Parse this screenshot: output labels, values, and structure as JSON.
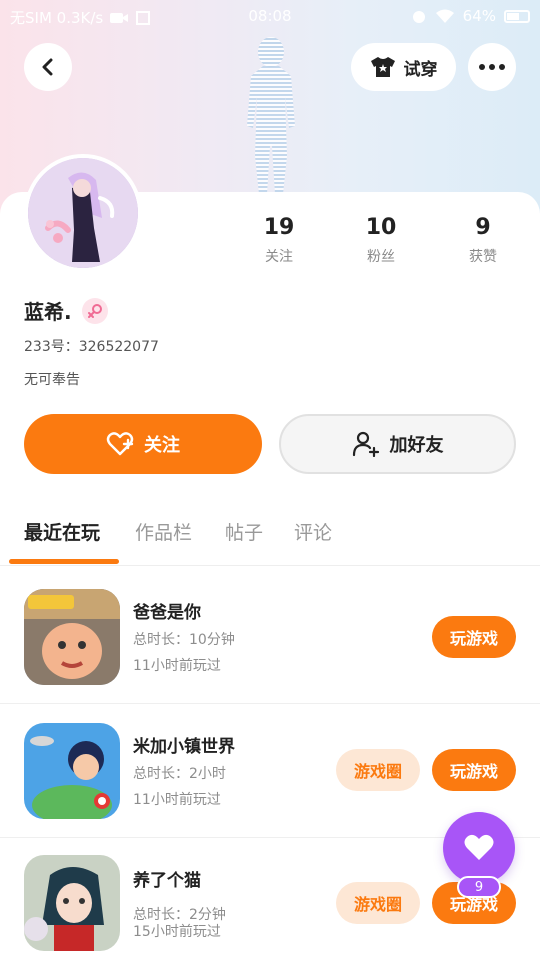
{
  "status_bar": {
    "left_text": "无SIM 0.3K/s",
    "time": "08:08",
    "battery": "64%"
  },
  "header": {
    "tryon_label": "试穿"
  },
  "profile": {
    "name": "蓝希.",
    "uid": "233号：326522077",
    "bio": "无可奉告",
    "stats": [
      {
        "value": "19",
        "label": "关注"
      },
      {
        "value": "10",
        "label": "粉丝"
      },
      {
        "value": "9",
        "label": "获赞"
      }
    ]
  },
  "actions": {
    "follow_label": "关注",
    "add_friend_label": "加好友"
  },
  "tabs": [
    {
      "label": "最近在玩",
      "active": true
    },
    {
      "label": "作品栏",
      "active": false
    },
    {
      "label": "帖子",
      "active": false
    },
    {
      "label": "评论",
      "active": false
    }
  ],
  "games": [
    {
      "title": "爸爸是你",
      "duration": "总时长：10分钟",
      "last_played": "11小时前玩过",
      "play_label": "玩游戏",
      "icon": "baby-game-icon"
    },
    {
      "title": "米加小镇世界",
      "duration": "总时长：2小时",
      "last_played": "11小时前玩过",
      "circle_label": "游戏圈",
      "play_label": "玩游戏",
      "icon": "town-game-icon"
    },
    {
      "title": "养了个猫",
      "duration": "总时长：2分钟",
      "last_played": "15小时前玩过",
      "circle_label": "游戏圈",
      "play_label": "玩游戏",
      "icon": "cat-girl-game-icon"
    }
  ],
  "fab": {
    "badge": "9",
    "icon": "heart-icon"
  },
  "colors": {
    "accent": "#fb7a10",
    "accent_soft": "#fde7d5",
    "fab": "#a855f7"
  }
}
